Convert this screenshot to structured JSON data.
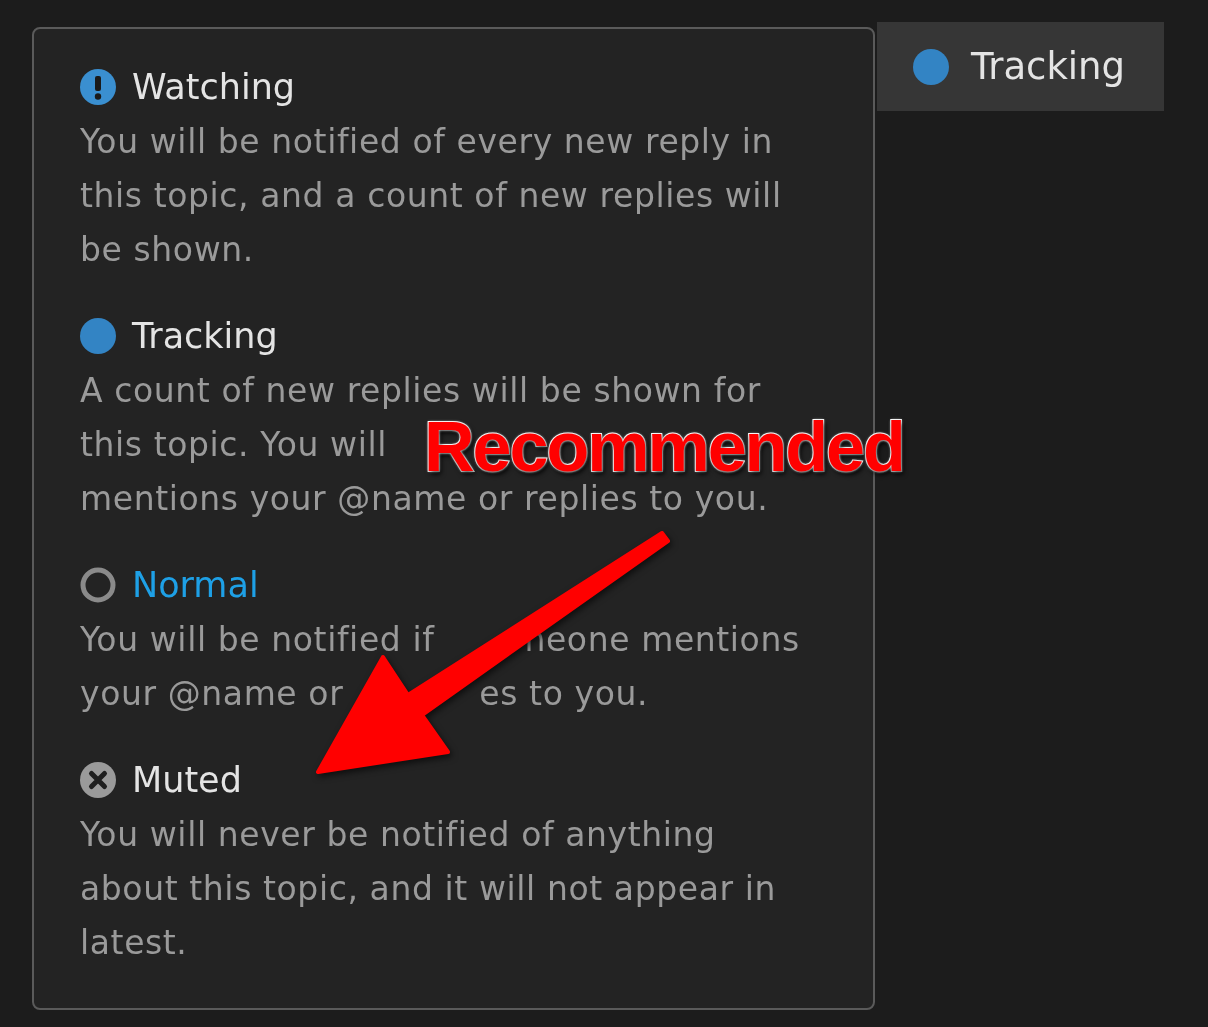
{
  "options": [
    {
      "kind": "watching",
      "title": "Watching",
      "selected": false,
      "lines": [
        [
          "You will be notified of every new reply in"
        ],
        [
          "this topic, and a count of new replies will"
        ],
        [
          "be shown."
        ]
      ]
    },
    {
      "kind": "tracking",
      "title": "Tracking",
      "selected": false,
      "lines": [
        [
          "A count of new replies will be shown for"
        ],
        [
          "this topic. You will"
        ],
        [
          "mentions your @name or replies to you."
        ]
      ]
    },
    {
      "kind": "normal",
      "title": "Normal",
      "selected": true,
      "lines": [
        [
          "You will be notified if",
          "neone mentions"
        ],
        [
          "your @name or",
          "es to you."
        ]
      ]
    },
    {
      "kind": "muted",
      "title": "Muted",
      "selected": false,
      "lines": [
        [
          "You will never be notified of anything"
        ],
        [
          "about this topic, and it will not appear in"
        ],
        [
          "latest."
        ]
      ]
    }
  ],
  "button": {
    "kind": "tracking",
    "label": "Tracking"
  },
  "annotation": {
    "label": "Recommended"
  }
}
